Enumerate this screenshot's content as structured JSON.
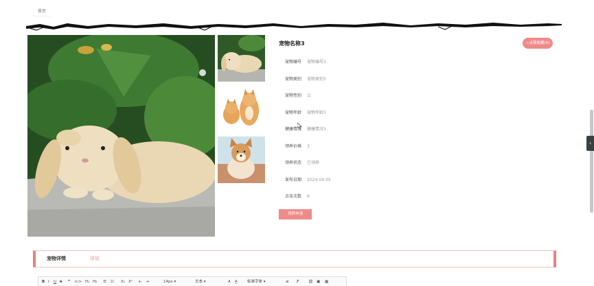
{
  "top_tab": {
    "label": "首页"
  },
  "pet": {
    "name": "宠物名称3",
    "favorite_label": "☆点我收藏(0)",
    "adopt_label": "领养申请",
    "fields": [
      {
        "label": "宠物编号",
        "value": "宠物编号3"
      },
      {
        "label": "宠物类别",
        "value": "宠物类别3"
      },
      {
        "label": "宠物性别",
        "value": "公"
      },
      {
        "label": "宠物年龄",
        "value": "宠物年龄3"
      },
      {
        "label": "健康情况",
        "value": "健康情况3"
      },
      {
        "label": "领养价格",
        "value": "3"
      },
      {
        "label": "领养状态",
        "value": "已领养"
      },
      {
        "label": "发布日期",
        "value": "2024-04-05"
      },
      {
        "label": "点击次数",
        "value": "6"
      }
    ]
  },
  "tabs": [
    {
      "label": "宠物详情",
      "active": true
    },
    {
      "label": "评论",
      "active": false
    }
  ],
  "editor": {
    "font_size": "14px",
    "text_type": "文本",
    "font_family": "标准字体"
  },
  "colors": {
    "accent": "#ef8a8a",
    "tab_border": "#ea7f7f"
  },
  "icons": [
    "bold-icon",
    "italic-icon",
    "underline-icon",
    "strikethrough-icon",
    "quote-icon",
    "code-icon",
    "heading1-icon",
    "heading2-icon",
    "ordered-list-icon",
    "bullet-list-icon",
    "subscript-icon",
    "superscript-icon",
    "outdent-icon",
    "indent-icon",
    "font-color-icon",
    "background-color-icon",
    "align-icon",
    "clear-format-icon",
    "link-icon",
    "image-icon",
    "video-icon",
    "chevron-left-icon"
  ]
}
